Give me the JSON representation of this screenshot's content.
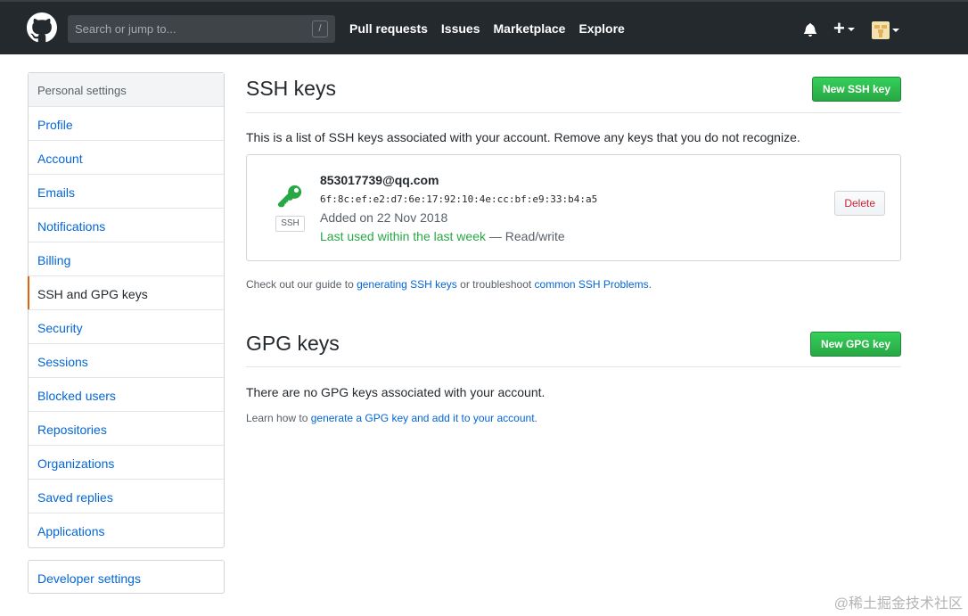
{
  "header": {
    "search_placeholder": "Search or jump to...",
    "search_shortcut": "/",
    "nav": [
      "Pull requests",
      "Issues",
      "Marketplace",
      "Explore"
    ]
  },
  "sidebar": {
    "heading": "Personal settings",
    "items": [
      {
        "label": "Profile"
      },
      {
        "label": "Account"
      },
      {
        "label": "Emails"
      },
      {
        "label": "Notifications"
      },
      {
        "label": "Billing"
      },
      {
        "label": "SSH and GPG keys",
        "selected": true
      },
      {
        "label": "Security"
      },
      {
        "label": "Sessions"
      },
      {
        "label": "Blocked users"
      },
      {
        "label": "Repositories"
      },
      {
        "label": "Organizations"
      },
      {
        "label": "Saved replies"
      },
      {
        "label": "Applications"
      }
    ],
    "developer_settings": "Developer settings"
  },
  "ssh": {
    "title": "SSH keys",
    "new_button": "New SSH key",
    "description": "This is a list of SSH keys associated with your account. Remove any keys that you do not recognize.",
    "key": {
      "type_label": "SSH",
      "title": "853017739@qq.com",
      "fingerprint": "6f:8c:ef:e2:d7:6e:17:92:10:4e:cc:bf:e9:33:b4:a5",
      "added": "Added on 22 Nov 2018",
      "last_used": "Last used within the last week",
      "access": " — Read/write",
      "delete_button": "Delete"
    },
    "guide": {
      "prefix": "Check out our guide to ",
      "link1": "generating SSH keys",
      "middle": " or troubleshoot ",
      "link2": "common SSH Problems",
      "suffix": "."
    }
  },
  "gpg": {
    "title": "GPG keys",
    "new_button": "New GPG key",
    "empty": "There are no GPG keys associated with your account.",
    "learn": {
      "prefix": "Learn how to ",
      "link": "generate a GPG key and add it to your account",
      "suffix": "."
    }
  },
  "watermark": "@稀土掘金技术社区",
  "colors": {
    "header_bg": "#24292e",
    "link": "#0366d6",
    "green": "#28a745",
    "selected_accent": "#e36209",
    "danger": "#cb2431"
  }
}
